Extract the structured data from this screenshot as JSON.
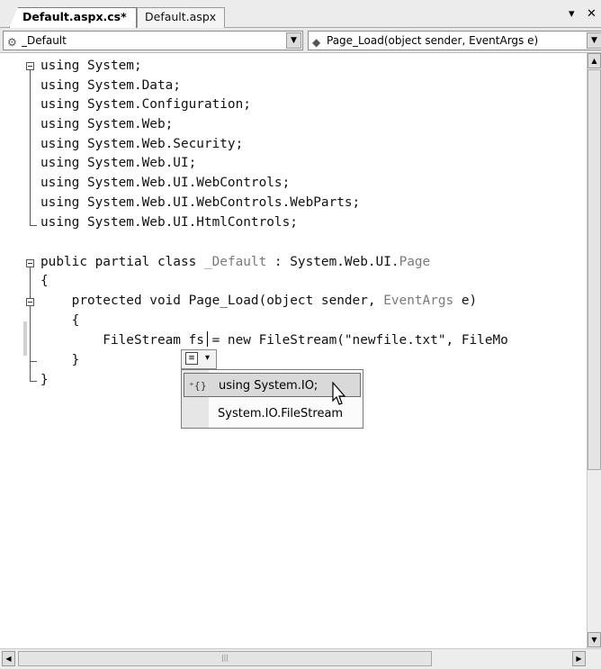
{
  "tabs": [
    {
      "label": "Default.aspx.cs*",
      "active": true
    },
    {
      "label": "Default.aspx",
      "active": false
    }
  ],
  "tab_controls": {
    "dropdown_icon": "chevron-down-icon",
    "close_icon": "close-icon",
    "dropdown_glyph": "▾",
    "close_glyph": "✕"
  },
  "navbar": {
    "class_combo": {
      "value": "_Default",
      "icon": "class-icon"
    },
    "member_combo": {
      "value": "Page_Load(object sender, EventArgs e)",
      "icon": "method-icon"
    }
  },
  "code_lines": [
    "using System;",
    "using System.Data;",
    "using System.Configuration;",
    "using System.Web;",
    "using System.Web.Security;",
    "using System.Web.UI;",
    "using System.Web.UI.WebControls;",
    "using System.Web.UI.WebControls.WebParts;",
    "using System.Web.UI.HtmlControls;",
    "",
    "public partial class _Default : System.Web.UI.Page",
    "{",
    "    protected void Page_Load(object sender, EventArgs e)",
    "    {",
    "        FileStream fs = new FileStream(\"newfile.txt\", FileMo",
    "    }",
    "}"
  ],
  "smart_tag": {
    "icon": "smart-tag-icon",
    "arrow": "▾"
  },
  "menu": {
    "items": [
      {
        "label": "using System.IO;",
        "highlighted": true,
        "icon": "add-using-icon"
      },
      {
        "label": "System.IO.FileStream",
        "highlighted": false
      }
    ]
  },
  "colors": {
    "type_name": "#7a7a7a",
    "highlight": "#d9d9d9"
  }
}
